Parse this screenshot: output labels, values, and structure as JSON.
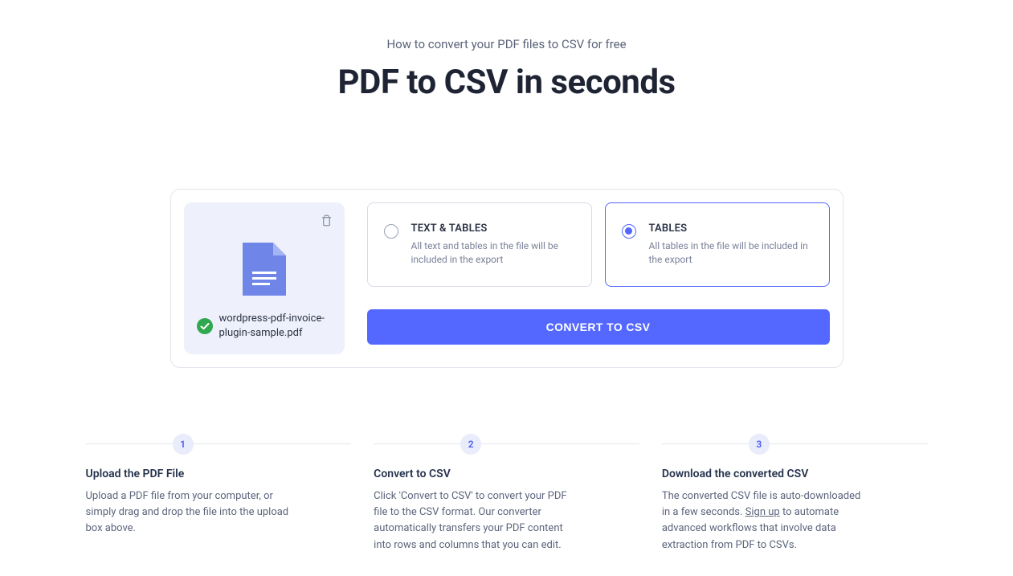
{
  "hero": {
    "subtitle": "How to convert your PDF files to CSV for free",
    "title": "PDF to CSV in seconds"
  },
  "file": {
    "name": "wordpress-pdf-invoice-plugin-sample.pdf",
    "icon": "document-icon",
    "status_icon": "check-circle-icon"
  },
  "options": [
    {
      "id": "text-tables",
      "title": "TEXT & TABLES",
      "description": "All text and tables in the file will be included in the export",
      "selected": false
    },
    {
      "id": "tables",
      "title": "TABLES",
      "description": "All tables in the file will be included in the export",
      "selected": true
    }
  ],
  "actions": {
    "convert_label": "CONVERT TO CSV"
  },
  "steps": [
    {
      "num": "1",
      "title": "Upload the PDF File",
      "body": "Upload a PDF file from your computer, or simply drag and drop the file into the upload box above."
    },
    {
      "num": "2",
      "title": "Convert to CSV",
      "body": "Click 'Convert to CSV' to convert your PDF file to the CSV format. Our converter automatically transfers your PDF content into rows and columns that you can edit."
    },
    {
      "num": "3",
      "title": "Download the converted CSV",
      "body_pre": "The converted CSV file is auto-downloaded in a few seconds. ",
      "link_text": "Sign up",
      "body_post": " to automate advanced workflows that involve data extraction from PDF to CSVs."
    }
  ],
  "colors": {
    "accent": "#5468ff"
  }
}
